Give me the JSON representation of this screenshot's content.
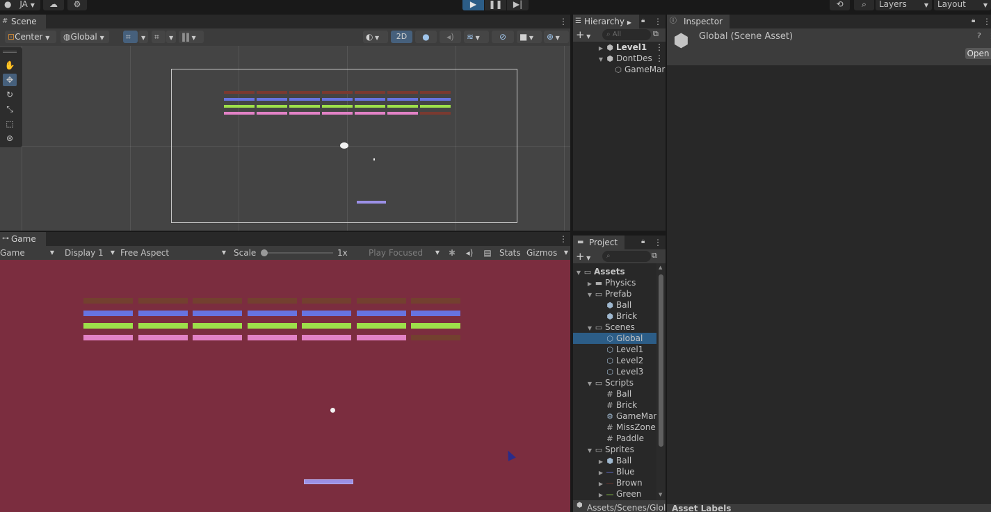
{
  "topbar": {
    "account_label": "JA",
    "layers_label": "Layers",
    "layout_label": "Layout",
    "colors": {
      "play_button_bg": "#2c5d87"
    }
  },
  "scene_panel": {
    "tab_label": "Scene",
    "pivot_label": "Center",
    "space_label": "Global",
    "mode_2d_label": "2D"
  },
  "game_panel": {
    "tab_label": "Game",
    "view_label": "Game",
    "display_label": "Display 1",
    "aspect_label": "Free Aspect",
    "scale_label": "Scale",
    "scale_value": "1x",
    "play_focus_label": "Play Focused",
    "stats_label": "Stats",
    "gizmos_label": "Gizmos",
    "background_color": "#7b2d3f"
  },
  "bricks": {
    "colors": {
      "brown": "#7a3a30",
      "blue": "#6773e0",
      "green": "#9de04a",
      "pink": "#e282c6",
      "game_brown": "#73402f",
      "paddle": "#9b90e6"
    },
    "rows": [
      [
        "brown",
        "brown",
        "brown",
        "brown",
        "brown",
        "brown",
        "brown"
      ],
      [
        "blue",
        "blue",
        "blue",
        "blue",
        "blue",
        "blue",
        "blue"
      ],
      [
        "green",
        "green",
        "green",
        "green",
        "green",
        "green",
        "green"
      ],
      [
        "pink",
        "pink",
        "pink",
        "pink",
        "pink",
        "pink",
        "brown"
      ]
    ]
  },
  "hierarchy": {
    "tab_label": "Hierarchy",
    "search_placeholder": "All",
    "items": [
      {
        "label": "Level1",
        "bold": true
      },
      {
        "label": "DontDes",
        "bold": false
      },
      {
        "label": "GameMar",
        "bold": false
      }
    ]
  },
  "inspector": {
    "tab_label": "Inspector",
    "title": "Global (Scene Asset)",
    "open_button": "Open",
    "asset_labels": "Asset Labels"
  },
  "project": {
    "tab_label": "Project",
    "path": "Assets/Scenes/Glol",
    "tree": [
      {
        "label": "Assets",
        "icon": "folder-open-icon",
        "level": 0,
        "expanded": true,
        "bold": true
      },
      {
        "label": "Physics",
        "icon": "folder-icon",
        "level": 1,
        "expanded": false
      },
      {
        "label": "Prefab",
        "icon": "folder-open-icon",
        "level": 1,
        "expanded": true
      },
      {
        "label": "Ball",
        "icon": "prefab-icon",
        "level": 2
      },
      {
        "label": "Brick",
        "icon": "prefab-icon",
        "level": 2
      },
      {
        "label": "Scenes",
        "icon": "folder-open-icon",
        "level": 1,
        "expanded": true
      },
      {
        "label": "Global",
        "icon": "scene-icon",
        "level": 2,
        "selected": true
      },
      {
        "label": "Level1",
        "icon": "scene-icon",
        "level": 2
      },
      {
        "label": "Level2",
        "icon": "scene-icon",
        "level": 2
      },
      {
        "label": "Level3",
        "icon": "scene-icon",
        "level": 2
      },
      {
        "label": "Scripts",
        "icon": "folder-open-icon",
        "level": 1,
        "expanded": true
      },
      {
        "label": "Ball",
        "icon": "script-icon",
        "level": 2
      },
      {
        "label": "Brick",
        "icon": "script-icon",
        "level": 2
      },
      {
        "label": "GameMan",
        "icon": "gear-script-icon",
        "level": 2
      },
      {
        "label": "MissZone",
        "icon": "script-icon",
        "level": 2
      },
      {
        "label": "Paddle",
        "icon": "script-icon",
        "level": 2
      },
      {
        "label": "Sprites",
        "icon": "folder-open-icon",
        "level": 1,
        "expanded": true
      },
      {
        "label": "Ball",
        "icon": "prefab-icon",
        "level": 2,
        "collapsed": true
      },
      {
        "label": "Blue",
        "icon": "sprite-blue-icon",
        "level": 2,
        "collapsed": true
      },
      {
        "label": "Brown",
        "icon": "sprite-brown-icon",
        "level": 2,
        "collapsed": true
      },
      {
        "label": "Green",
        "icon": "sprite-green-icon",
        "level": 2,
        "collapsed": true
      }
    ]
  }
}
